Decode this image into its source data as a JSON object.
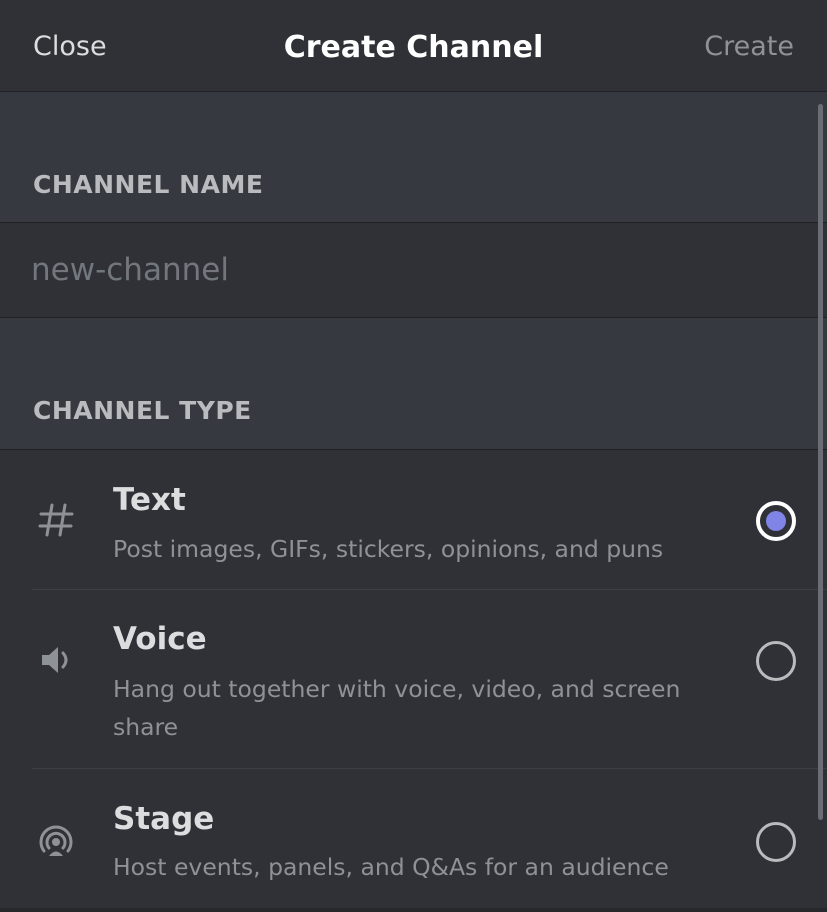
{
  "header": {
    "close_label": "Close",
    "title": "Create Channel",
    "create_label": "Create"
  },
  "channel_name": {
    "section_label": "CHANNEL NAME",
    "placeholder": "new-channel",
    "value": ""
  },
  "channel_type": {
    "section_label": "CHANNEL TYPE",
    "selected": "text",
    "options": [
      {
        "id": "text",
        "icon": "hash-icon",
        "name": "Text",
        "description": "Post images, GIFs, stickers, opinions, and puns"
      },
      {
        "id": "voice",
        "icon": "speaker-icon",
        "name": "Voice",
        "description": "Hang out together with voice, video, and screen share"
      },
      {
        "id": "stage",
        "icon": "stage-broadcast-icon",
        "name": "Stage",
        "description": "Host events, panels, and Q&As for an audience"
      }
    ]
  },
  "colors": {
    "background": "#36393f",
    "panel": "#2f3136",
    "accent": "#7f84e6",
    "text_primary": "#dcddde",
    "text_muted": "#8e9297"
  }
}
